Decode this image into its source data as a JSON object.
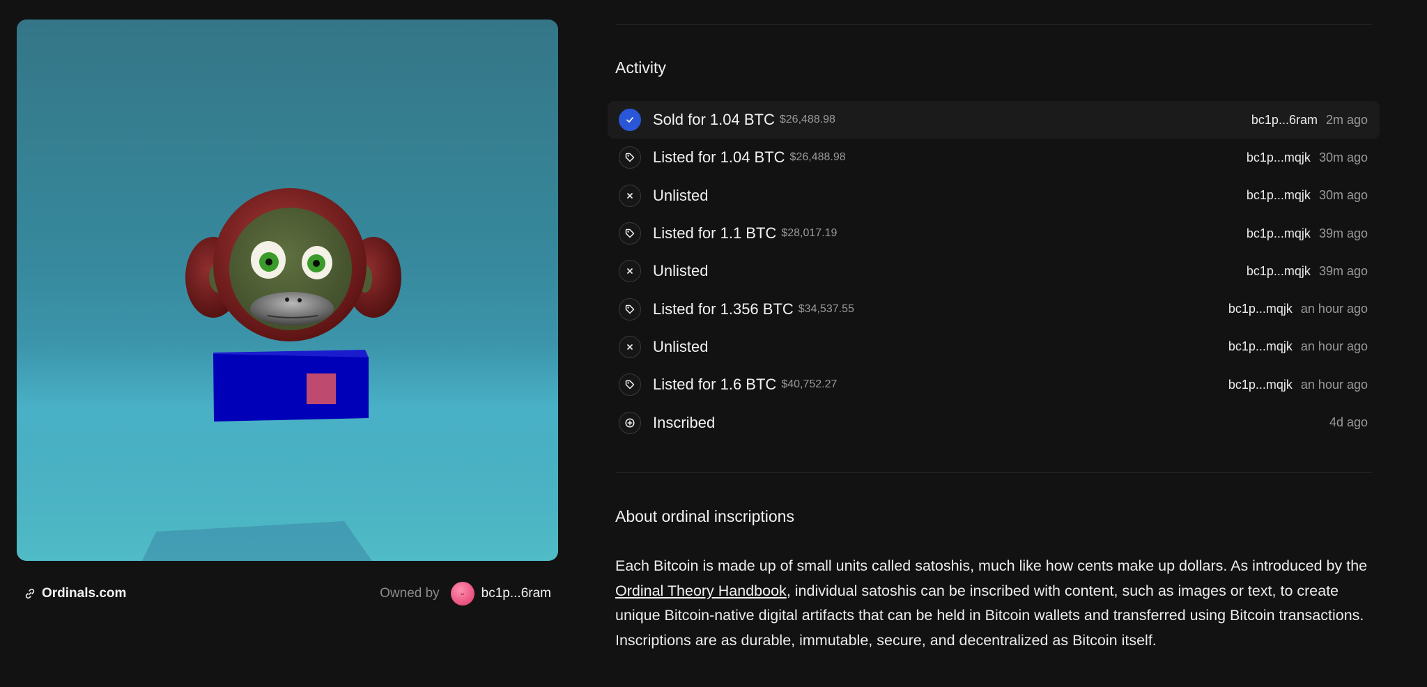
{
  "media": {
    "alt": "3D monkey inscription"
  },
  "footer": {
    "site_link_label": "Ordinals.com",
    "owned_by_label": "Owned by",
    "owner_address": "bc1p...6ram"
  },
  "activity": {
    "title": "Activity",
    "events": [
      {
        "type": "sold",
        "icon": "check-icon",
        "text": "Sold for 1.04 BTC",
        "usd": "$26,488.98",
        "address": "bc1p...6ram",
        "time": "2m ago"
      },
      {
        "type": "listed",
        "icon": "tag-icon",
        "text": "Listed for 1.04 BTC",
        "usd": "$26,488.98",
        "address": "bc1p...mqjk",
        "time": "30m ago"
      },
      {
        "type": "unlisted",
        "icon": "x-icon",
        "text": "Unlisted",
        "usd": "",
        "address": "bc1p...mqjk",
        "time": "30m ago"
      },
      {
        "type": "listed",
        "icon": "tag-icon",
        "text": "Listed for 1.1 BTC",
        "usd": "$28,017.19",
        "address": "bc1p...mqjk",
        "time": "39m ago"
      },
      {
        "type": "unlisted",
        "icon": "x-icon",
        "text": "Unlisted",
        "usd": "",
        "address": "bc1p...mqjk",
        "time": "39m ago"
      },
      {
        "type": "listed",
        "icon": "tag-icon",
        "text": "Listed for 1.356 BTC",
        "usd": "$34,537.55",
        "address": "bc1p...mqjk",
        "time": "an hour ago"
      },
      {
        "type": "unlisted",
        "icon": "x-icon",
        "text": "Unlisted",
        "usd": "",
        "address": "bc1p...mqjk",
        "time": "an hour ago"
      },
      {
        "type": "listed",
        "icon": "tag-icon",
        "text": "Listed for 1.6 BTC",
        "usd": "$40,752.27",
        "address": "bc1p...mqjk",
        "time": "an hour ago"
      },
      {
        "type": "inscribed",
        "icon": "plus-circle-icon",
        "text": "Inscribed",
        "usd": "",
        "address": "",
        "time": "4d ago"
      }
    ]
  },
  "about": {
    "title": "About ordinal inscriptions",
    "text_before_link": "Each Bitcoin is made up of small units called satoshis, much like how cents make up dollars. As introduced by the ",
    "link_label": "Ordinal Theory Handbook",
    "text_after_link": ", individual satoshis can be inscribed with content, such as images or text, to create unique Bitcoin-native digital artifacts that can be held in Bitcoin wallets and transferred using Bitcoin transactions. Inscriptions are as durable, immutable, secure, and decentralized as Bitcoin itself."
  },
  "colors": {
    "background": "#121212",
    "sold_accent": "#2a56d8",
    "muted_text": "#9a9a9a"
  }
}
